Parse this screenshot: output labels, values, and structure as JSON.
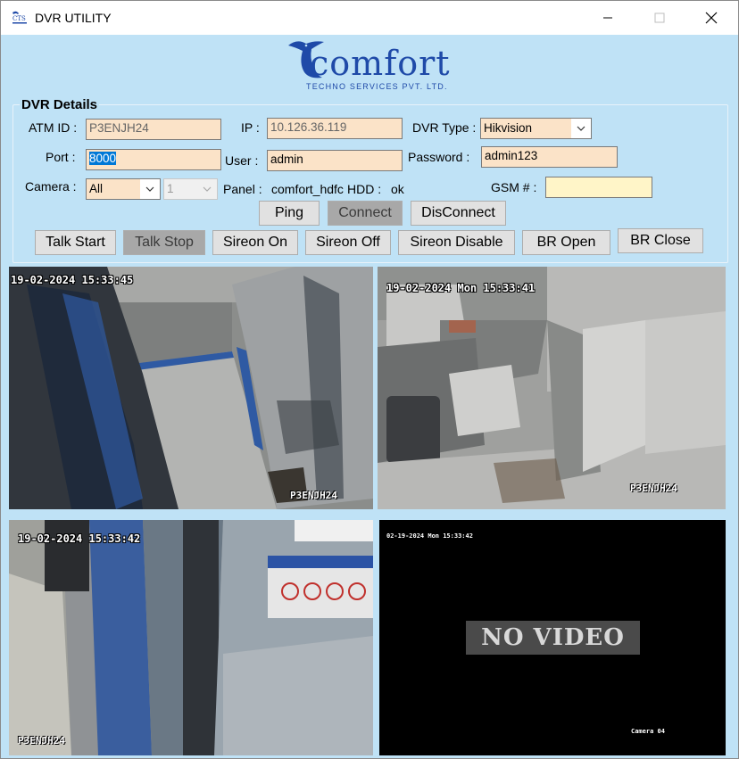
{
  "window": {
    "title": "DVR UTILITY"
  },
  "logo": {
    "wordmark": "comfort",
    "subtitle": "TECHNO SERVICES PVT. LTD."
  },
  "dvr_details": {
    "group_title": "DVR Details",
    "atm_id": {
      "label": "ATM ID :",
      "value": "P3ENJH24"
    },
    "ip": {
      "label": "IP :",
      "value": "10.126.36.119"
    },
    "dvr_type": {
      "label": "DVR Type :",
      "value": "Hikvision"
    },
    "port": {
      "label": "Port :",
      "value": "8000"
    },
    "user": {
      "label": "User :",
      "value": "admin"
    },
    "password": {
      "label": "Password :",
      "value": "admin123"
    },
    "camera": {
      "label": "Camera :",
      "value": "All",
      "channel": "1"
    },
    "panel": {
      "label": "Panel :",
      "value": "comfort_hdfc"
    },
    "hdd": {
      "label": "HDD :",
      "value": "ok"
    },
    "gsm": {
      "label": "GSM # :",
      "value": ""
    }
  },
  "buttons": {
    "ping": "Ping",
    "connect": "Connect",
    "disconnect": "DisConnect",
    "talk_start": "Talk Start",
    "talk_stop": "Talk Stop",
    "sireon_on": "Sireon On",
    "sireon_off": "Sireon Off",
    "sireon_disable": "Sireon Disable",
    "br_open": "BR Open",
    "br_close": "BR Close"
  },
  "cameras": [
    {
      "timestamp": "19-02-2024 15:33:45",
      "name": "P3ENJH24"
    },
    {
      "timestamp": "19-02-2024 Mon 15:33:41",
      "name": "P3ENJH24"
    },
    {
      "timestamp": "19-02-2024 15:33:42",
      "name": "P3ENJH24"
    },
    {
      "timestamp": "02-19-2024 Mon 15:33:42",
      "status": "NO VIDEO",
      "name": "Camera 04"
    }
  ],
  "colors": {
    "window_bg": "#bfe2f6",
    "field_bg": "#fbe3c8",
    "gsm_bg": "#fff5c8",
    "logo": "#1f4aa8"
  }
}
